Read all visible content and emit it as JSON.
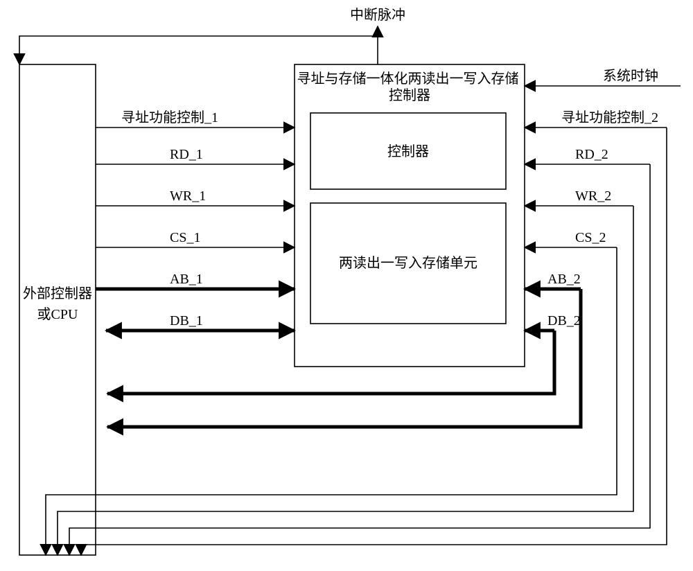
{
  "top_label": "中断脉冲",
  "left_block": {
    "line1": "外部控制器",
    "line2": "或CPU"
  },
  "center_block": {
    "title": "寻址与存储一体化两读出一写入存储控制器",
    "sub_top": "控制器",
    "sub_bottom": "两读出一写入存储单元"
  },
  "left_signals": [
    "寻址功能控制_1",
    "RD_1",
    "WR_1",
    "CS_1",
    "AB_1",
    "DB_1"
  ],
  "right_signals": [
    "系统时钟",
    "寻址功能控制_2",
    "RD_2",
    "WR_2",
    "CS_2",
    "AB_2",
    "DB_2"
  ]
}
